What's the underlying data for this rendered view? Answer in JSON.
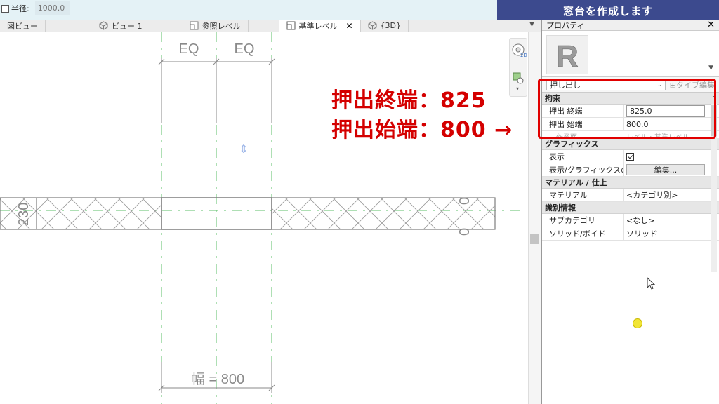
{
  "options_bar": {
    "radius_label": "半径:",
    "radius_value": "1000.0"
  },
  "banner": {
    "text": "窓台を作成します"
  },
  "tabs": [
    {
      "label": "図ビュー",
      "icon": "floor-plan-icon",
      "active": false
    },
    {
      "label": "ビュー 1",
      "icon": "3d-view-icon",
      "active": false
    },
    {
      "label": "参照レベル",
      "icon": "level-view-icon",
      "active": false
    },
    {
      "label": "基準レベル",
      "icon": "level-view-icon",
      "active": true
    },
    {
      "label": "{3D}",
      "icon": "3d-view-icon",
      "active": false
    }
  ],
  "drawing": {
    "eq_left": "EQ",
    "eq_right": "EQ",
    "thickness": "230",
    "width_dim": "幅 = 800",
    "right_dim_top": "0",
    "right_dim_bottom": "0",
    "line_color": "#8a8a8a",
    "ref_plane_color": "#5cbf6a"
  },
  "properties": {
    "title": "プロパティ",
    "logo_letter": "R",
    "filter_selected": "押し出し",
    "edit_type": "タイプ編集",
    "categories": {
      "constraints": "拘束",
      "graphics": "グラフィックス",
      "materials": "マテリアル / 仕上",
      "identity": "識別情報"
    },
    "rows": {
      "extrusion_end_label": "押出 終端",
      "extrusion_end_value": "825.0",
      "extrusion_start_label": "押出 始端",
      "extrusion_start_value": "800.0",
      "work_plane_label": "作業面",
      "work_plane_value": "レベル : 基準レベル",
      "visible_label": "表示",
      "vis_graphics_label": "表示/グラフィックスの...",
      "vis_graphics_button": "編集...",
      "material_label": "マテリアル",
      "material_value": "<カテゴリ別>",
      "subcategory_label": "サブカテゴリ",
      "subcategory_value": "<なし>",
      "solid_void_label": "ソリッド/ボイド",
      "solid_void_value": "ソリッド"
    }
  },
  "annotations": {
    "line1": "押出終端：825",
    "line2": "押出始端：800 →",
    "color": "#d40000"
  }
}
